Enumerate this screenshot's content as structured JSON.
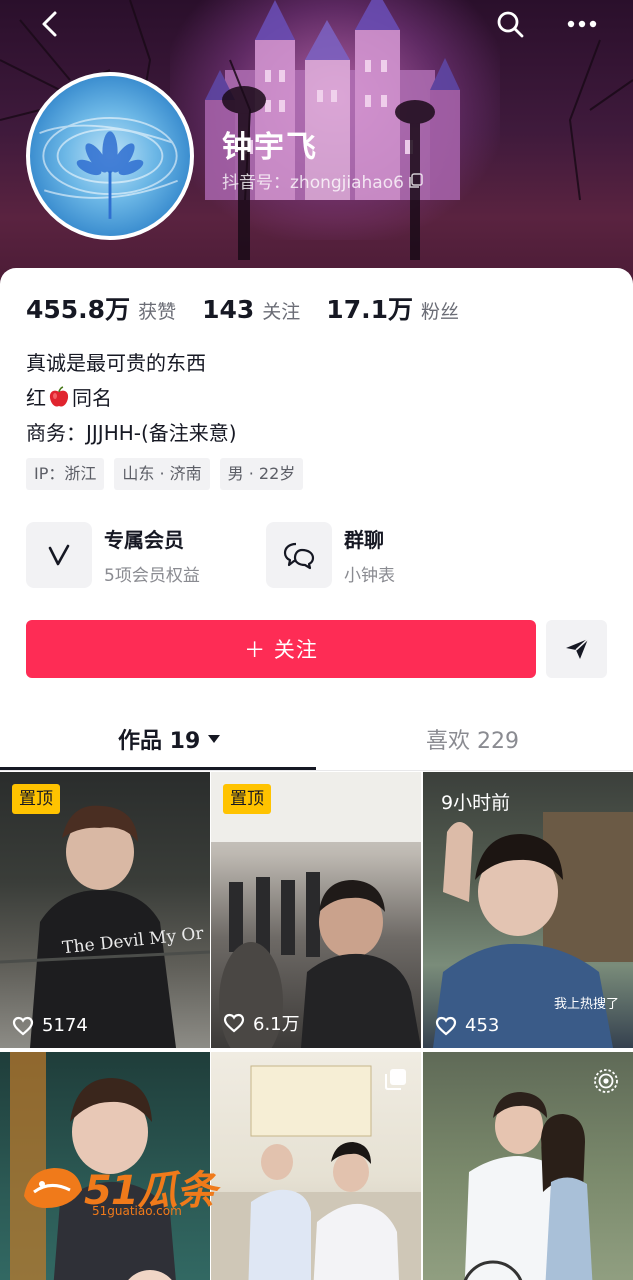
{
  "header": {
    "nickname": "钟宇飞",
    "douyin_id": "抖音号：zhongjiahao6",
    "icons": [
      "back-arrow-icon",
      "search-icon",
      "more-icon",
      "copy-icon"
    ]
  },
  "stats": [
    {
      "value": "455.8万",
      "label": "获赞"
    },
    {
      "value": "143",
      "label": "关注"
    },
    {
      "value": "17.1万",
      "label": "粉丝"
    }
  ],
  "bio": {
    "line1": "真诚是最可贵的东西",
    "line2_prefix": "红",
    "line2_suffix": "同名",
    "line3": "商务：JJJHH-(备注来意)"
  },
  "tags": [
    "IP：浙江",
    "山东 · 济南",
    "男 · 22岁"
  ],
  "features": [
    {
      "title": "专属会员",
      "subtitle": "5项会员权益",
      "icon": "vip-v-icon"
    },
    {
      "title": "群聊",
      "subtitle": "小钟表",
      "icon": "group-chat-icon"
    }
  ],
  "actions": {
    "follow_label": "＋ 关注",
    "share_icon": "share-send-icon"
  },
  "tabs": {
    "works_label": "作品 19",
    "likes_label": "喜欢 229"
  },
  "videos": [
    {
      "pinned_label": "置顶",
      "likes": "5174",
      "overlay_text": "The Devil My Or"
    },
    {
      "pinned_label": "置顶",
      "likes": "6.1万"
    },
    {
      "time_label": "9小时前",
      "likes": "453",
      "caption": "我上热搜了"
    },
    {},
    {},
    {}
  ],
  "watermark": {
    "brand": "51瓜条",
    "url": "51guatiao.com"
  },
  "colors": {
    "accent": "#fe2c55",
    "pin_badge": "#ffc300",
    "text_primary": "#161823",
    "text_secondary": "#8a8b91"
  }
}
